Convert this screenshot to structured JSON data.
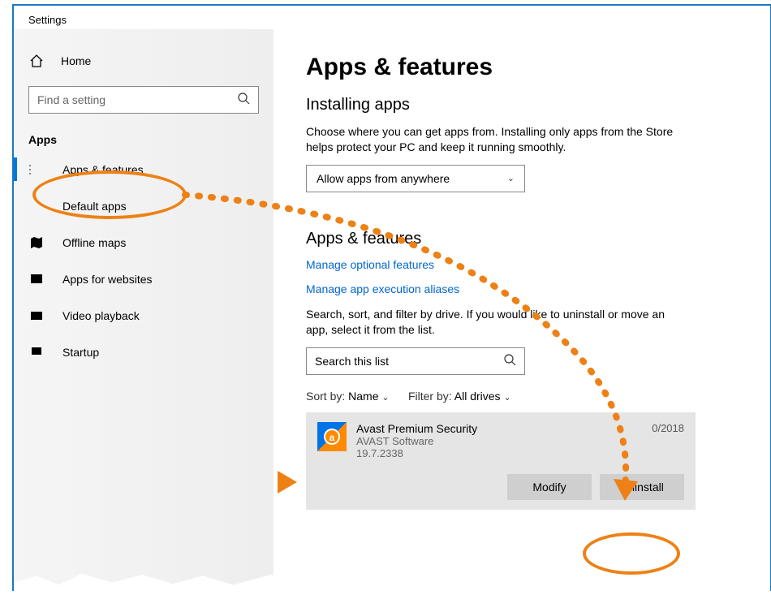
{
  "window_title": "Settings",
  "sidebar": {
    "home": "Home",
    "search_placeholder": "Find a setting",
    "section": "Apps",
    "items": [
      {
        "label": "Apps & features",
        "selected": true,
        "icon": "list-icon"
      },
      {
        "label": "Default apps",
        "icon": "defaults-icon"
      },
      {
        "label": "Offline maps",
        "icon": "map-icon"
      },
      {
        "label": "Apps for websites",
        "icon": "websites-icon"
      },
      {
        "label": "Video playback",
        "icon": "video-icon"
      },
      {
        "label": "Startup",
        "icon": "startup-icon"
      }
    ]
  },
  "main": {
    "title": "Apps & features",
    "installing_heading": "Installing apps",
    "installing_desc": "Choose where you can get apps from. Installing only apps from the Store helps protect your PC and keep it running smoothly.",
    "source_dropdown": "Allow apps from anywhere",
    "apps_heading": "Apps & features",
    "link_optional": "Manage optional features",
    "link_aliases": "Manage app execution aliases",
    "search_desc": "Search, sort, and filter by drive. If you would like to uninstall or move an app, select it from the list.",
    "list_search_placeholder": "Search this list",
    "sort_label": "Sort by:",
    "sort_value": "Name",
    "filter_label": "Filter by:",
    "filter_value": "All drives",
    "app": {
      "name": "Avast Premium Security",
      "publisher": "AVAST Software",
      "version": "19.7.2338",
      "date_fragment": "0/2018",
      "modify": "Modify",
      "uninstall": "Uninstall"
    }
  },
  "colors": {
    "accent": "#0078d7",
    "link": "#0066cc",
    "annotation": "#ed8115"
  }
}
